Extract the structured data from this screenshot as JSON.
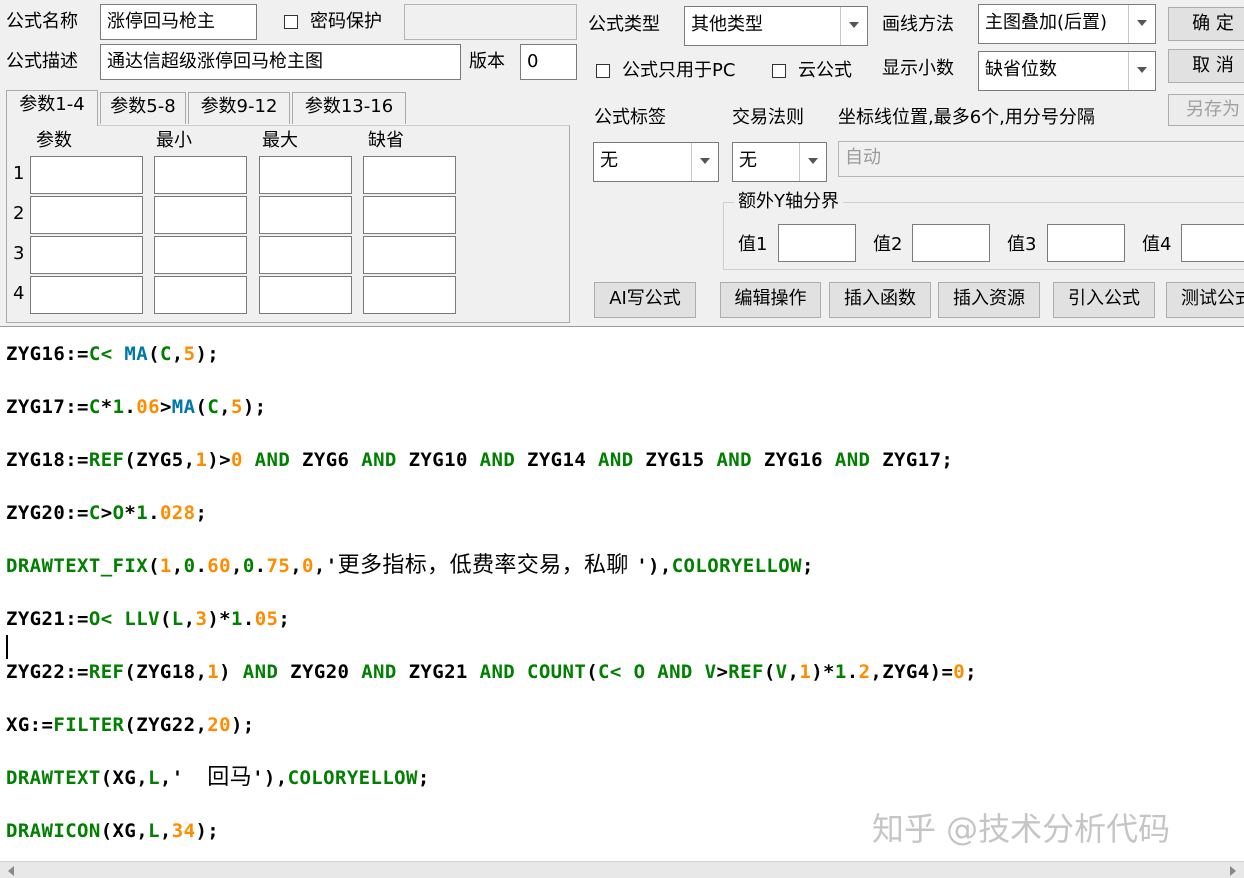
{
  "header": {
    "name_label": "公式名称",
    "name_value": "涨停回马枪主",
    "password_label": "密码保护",
    "desc_label": "公式描述",
    "desc_value": "通达信超级涨停回马枪主图",
    "version_label": "版本",
    "version_value": "0"
  },
  "tabs": [
    "参数1-4",
    "参数5-8",
    "参数9-12",
    "参数13-16"
  ],
  "params": {
    "col_headers": [
      "参数",
      "最小",
      "最大",
      "缺省"
    ],
    "row_numbers": [
      "1",
      "2",
      "3",
      "4"
    ]
  },
  "right_panel": {
    "type_label": "公式类型",
    "type_value": "其他类型",
    "draw_label": "画线方法",
    "draw_value": "主图叠加(后置)",
    "pc_only_label": "公式只用于PC",
    "cloud_label": "云公式",
    "decimal_label": "显示小数",
    "decimal_value": "缺省位数",
    "tag_label": "公式标签",
    "tag_value": "无",
    "rule_label": "交易法则",
    "rule_value": "无",
    "axis_label": "坐标线位置,最多6个,用分号分隔",
    "axis_value": "自动",
    "yaxis_group": "额外Y轴分界",
    "v1": "值1",
    "v2": "值2",
    "v3": "值3",
    "v4": "值4"
  },
  "buttons": {
    "ok": "确 定",
    "cancel": "取 消",
    "save_as": "另存为",
    "ai": "AI写公式",
    "edit": "编辑操作",
    "insert_func": "插入函数",
    "insert_res": "插入资源",
    "import": "引入公式",
    "test": "测试公式"
  },
  "code": {
    "l1": [
      [
        "ZYG16:=",
        "k"
      ],
      [
        "C< ",
        "g"
      ],
      [
        "MA",
        "b"
      ],
      [
        "(",
        "k"
      ],
      [
        "C",
        "g"
      ],
      [
        ",",
        "k"
      ],
      [
        "5",
        "o"
      ],
      [
        ");",
        "k"
      ]
    ],
    "l2": [
      [
        "ZYG17:=",
        "k"
      ],
      [
        "C",
        "g"
      ],
      [
        "*",
        "k"
      ],
      [
        "1",
        "g"
      ],
      [
        ".",
        "k"
      ],
      [
        "06",
        "o"
      ],
      [
        ">",
        "k"
      ],
      [
        "MA",
        "b"
      ],
      [
        "(",
        "k"
      ],
      [
        "C",
        "g"
      ],
      [
        ",",
        "k"
      ],
      [
        "5",
        "o"
      ],
      [
        ");",
        "k"
      ]
    ],
    "l3": [
      [
        "ZYG18:=",
        "k"
      ],
      [
        "REF",
        "g"
      ],
      [
        "(ZYG5,",
        "k"
      ],
      [
        "1",
        "o"
      ],
      [
        ")>",
        "k"
      ],
      [
        "0",
        "o"
      ],
      [
        " AND ",
        "g"
      ],
      [
        "ZYG6",
        "k"
      ],
      [
        " AND ",
        "g"
      ],
      [
        "ZYG10",
        "k"
      ],
      [
        " AND ",
        "g"
      ],
      [
        "ZYG14",
        "k"
      ],
      [
        " AND ",
        "g"
      ],
      [
        "ZYG15",
        "k"
      ],
      [
        " AND ",
        "g"
      ],
      [
        "ZYG16",
        "k"
      ],
      [
        " AND ",
        "g"
      ],
      [
        "ZYG17;",
        "k"
      ]
    ],
    "l4": [
      [
        "ZYG20:=",
        "k"
      ],
      [
        "C",
        "g"
      ],
      [
        ">",
        "k"
      ],
      [
        "O",
        "g"
      ],
      [
        "*",
        "k"
      ],
      [
        "1",
        "g"
      ],
      [
        ".",
        "k"
      ],
      [
        "028",
        "o"
      ],
      [
        ";",
        "k"
      ]
    ],
    "l5": [
      [
        "DRAWTEXT_FIX",
        "g"
      ],
      [
        "(",
        "k"
      ],
      [
        "1",
        "o"
      ],
      [
        ",",
        "k"
      ],
      [
        "0",
        "g"
      ],
      [
        ".",
        "k"
      ],
      [
        "60",
        "o"
      ],
      [
        ",",
        "k"
      ],
      [
        "0",
        "g"
      ],
      [
        ".",
        "k"
      ],
      [
        "75",
        "o"
      ],
      [
        ",",
        "k"
      ],
      [
        "0",
        "o"
      ],
      [
        ",'",
        "k"
      ],
      [
        "更多指标，低费率交易，私聊 ",
        "t"
      ],
      [
        "'),",
        "k"
      ],
      [
        "COLORYELLOW",
        "g"
      ],
      [
        ";",
        "k"
      ]
    ],
    "l6": [
      [
        "ZYG21:=",
        "k"
      ],
      [
        "O< ",
        "g"
      ],
      [
        "LLV",
        "g"
      ],
      [
        "(",
        "k"
      ],
      [
        "L",
        "g"
      ],
      [
        ",",
        "k"
      ],
      [
        "3",
        "o"
      ],
      [
        ")*",
        "k"
      ],
      [
        "1",
        "g"
      ],
      [
        ".",
        "k"
      ],
      [
        "05",
        "o"
      ],
      [
        ";",
        "k"
      ]
    ],
    "l7": [
      [
        "ZYG22:=",
        "k"
      ],
      [
        "REF",
        "g"
      ],
      [
        "(ZYG18,",
        "k"
      ],
      [
        "1",
        "o"
      ],
      [
        ")",
        "k"
      ],
      [
        " AND ",
        "g"
      ],
      [
        "ZYG20",
        "k"
      ],
      [
        " AND ",
        "g"
      ],
      [
        "ZYG21",
        "k"
      ],
      [
        " AND ",
        "g"
      ],
      [
        "COUNT",
        "g"
      ],
      [
        "(",
        "k"
      ],
      [
        "C< ",
        "g"
      ],
      [
        "O",
        "g"
      ],
      [
        " AND ",
        "g"
      ],
      [
        "V",
        "g"
      ],
      [
        ">",
        "k"
      ],
      [
        "REF",
        "g"
      ],
      [
        "(",
        "k"
      ],
      [
        "V",
        "g"
      ],
      [
        ",",
        "k"
      ],
      [
        "1",
        "o"
      ],
      [
        ")*",
        "k"
      ],
      [
        "1",
        "g"
      ],
      [
        ".",
        "k"
      ],
      [
        "2",
        "o"
      ],
      [
        ",ZYG4)=",
        "k"
      ],
      [
        "0",
        "o"
      ],
      [
        ";",
        "k"
      ]
    ],
    "l8": [
      [
        "XG:=",
        "k"
      ],
      [
        "FILTER",
        "g"
      ],
      [
        "(ZYG22,",
        "k"
      ],
      [
        "20",
        "o"
      ],
      [
        ");",
        "k"
      ]
    ],
    "l9": [
      [
        "DRAWTEXT",
        "g"
      ],
      [
        "(XG,",
        "k"
      ],
      [
        "L",
        "g"
      ],
      [
        ",'  ",
        "k"
      ],
      [
        "回马",
        "t"
      ],
      [
        "'),",
        "k"
      ],
      [
        "COLORYELLOW",
        "g"
      ],
      [
        ";",
        "k"
      ]
    ],
    "l10": [
      [
        "DRAWICON",
        "g"
      ],
      [
        "(XG,",
        "k"
      ],
      [
        "L",
        "g"
      ],
      [
        ",",
        "k"
      ],
      [
        "34",
        "o"
      ],
      [
        ");",
        "k"
      ]
    ]
  },
  "watermark": "知乎 @技术分析代码"
}
